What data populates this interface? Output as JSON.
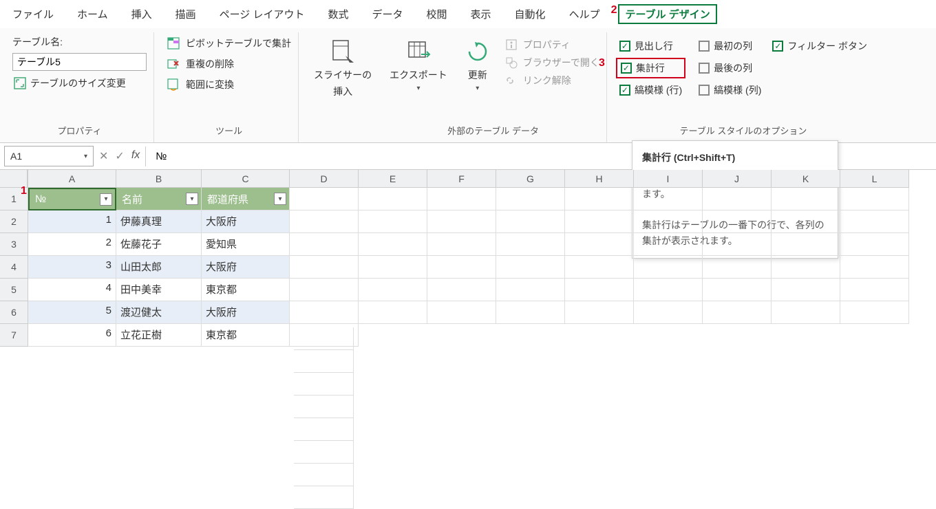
{
  "menubar": {
    "items": [
      "ファイル",
      "ホーム",
      "挿入",
      "描画",
      "ページ レイアウト",
      "数式",
      "データ",
      "校閲",
      "表示",
      "自動化",
      "ヘルプ"
    ],
    "table_design": "テーブル デザイン"
  },
  "annotations": {
    "a1": "1",
    "a2": "2",
    "a3": "3"
  },
  "ribbon": {
    "properties": {
      "table_name_label": "テーブル名:",
      "table_name_value": "テーブル5",
      "resize": "テーブルのサイズ変更",
      "group": "プロパティ"
    },
    "tools": {
      "pivot": "ピボットテーブルで集計",
      "dedupe": "重複の削除",
      "range": "範囲に変換",
      "group": "ツール"
    },
    "slicer": {
      "label1": "スライサーの",
      "label2": "挿入"
    },
    "export": {
      "label": "エクスポート"
    },
    "refresh": {
      "label": "更新"
    },
    "external": {
      "props": "プロパティ",
      "browser": "ブラウザーで開く",
      "unlink": "リンク解除",
      "group": "外部のテーブル データ"
    },
    "styleopt": {
      "header_row": "見出し行",
      "first_col": "最初の列",
      "total_row": "集計行",
      "last_col": "最後の列",
      "banded_rows": "縞模様 (行)",
      "banded_cols": "縞模様 (列)",
      "group": "テーブル スタイルのオプション"
    },
    "filter_btn": "フィルター ボタン"
  },
  "formula": {
    "name_box": "A1",
    "fx": "fx",
    "value": "№"
  },
  "sheet": {
    "cols": [
      "A",
      "B",
      "C",
      "D",
      "E",
      "F",
      "G",
      "H",
      "I",
      "J",
      "K",
      "L"
    ],
    "rows": [
      "1",
      "2",
      "3",
      "4",
      "5",
      "6",
      "7"
    ],
    "headers": [
      "№",
      "名前",
      "都道府県"
    ],
    "data": [
      {
        "no": "1",
        "name": "伊藤真理",
        "pref": "大阪府"
      },
      {
        "no": "2",
        "name": "佐藤花子",
        "pref": "愛知県"
      },
      {
        "no": "3",
        "name": "山田太郎",
        "pref": "大阪府"
      },
      {
        "no": "4",
        "name": "田中美幸",
        "pref": "東京都"
      },
      {
        "no": "5",
        "name": "渡辺健太",
        "pref": "大阪府"
      },
      {
        "no": "6",
        "name": "立花正樹",
        "pref": "東京都"
      }
    ]
  },
  "tooltip": {
    "title": "集計行 (Ctrl+Shift+T)",
    "line1": "テーブルの集計行を表示または非表示にします。",
    "line2": "集計行はテーブルの一番下の行で、各列の集計が表示されます。"
  }
}
